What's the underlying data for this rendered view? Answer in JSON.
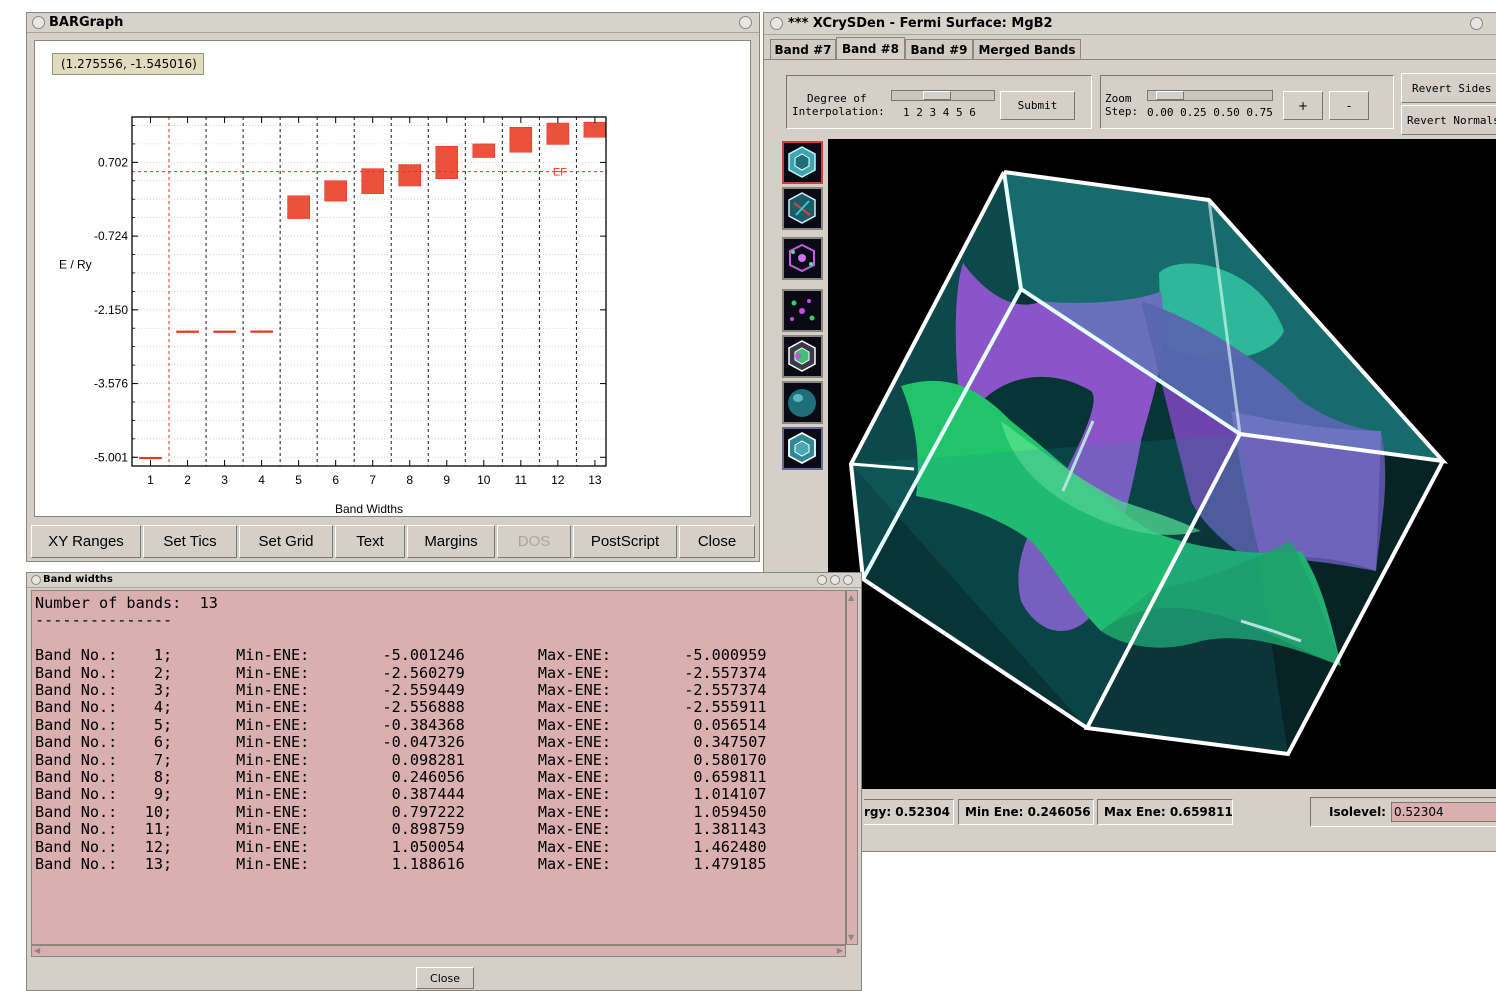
{
  "bargraph": {
    "title": "BARGraph",
    "coord_readout": "(1.275556, -1.545016)",
    "buttons": [
      "XY Ranges",
      "Set Tics",
      "Set Grid",
      "Text",
      "Margins",
      "DOS",
      "PostScript",
      "Close"
    ],
    "disabled_button": "DOS"
  },
  "chart_data": {
    "type": "bar",
    "xlabel": "Band Widths",
    "ylabel": "E / Ry",
    "x_ticks": [
      "1",
      "2",
      "3",
      "4",
      "5",
      "6",
      "7",
      "8",
      "9",
      "10",
      "11",
      "12",
      "13"
    ],
    "y_ticks": [
      "0.702",
      "-0.724",
      "-2.150",
      "-3.576",
      "-5.001"
    ],
    "y_tick_values": [
      0.702,
      -0.724,
      -2.15,
      -3.576,
      -5.001
    ],
    "ylim": [
      -5.17,
      1.58
    ],
    "xlim": [
      0.5,
      13.3
    ],
    "grid": true,
    "fermi_level": 0.52304,
    "fermi_label": "EF",
    "bar_color": "#e8341c",
    "series": [
      {
        "bands": [
          1,
          2,
          3,
          4,
          5,
          6,
          7,
          8,
          9,
          10,
          11,
          12,
          13
        ],
        "min": [
          -5.001246,
          -2.560279,
          -2.559449,
          -2.556888,
          -0.384368,
          -0.047326,
          0.098281,
          0.246056,
          0.387444,
          0.797222,
          0.898759,
          1.050054,
          1.188616
        ],
        "max": [
          -5.000959,
          -2.557374,
          -2.557374,
          -2.555911,
          0.056514,
          0.347507,
          0.58017,
          0.659811,
          1.014107,
          1.05945,
          1.381143,
          1.46248,
          1.479185
        ]
      }
    ]
  },
  "xcrysden": {
    "title": "*** XCrySDen - Fermi Surface: MgB2",
    "tabs": [
      "Band #7",
      "Band #8",
      "Band #9",
      "Merged Bands"
    ],
    "active_tab": "Band #8",
    "interp_label_1": "Degree of",
    "interp_label_2": "Interpolation:",
    "interp_scale": "1 2 3 4 5 6",
    "submit": "Submit",
    "zoom_label_1": "Zoom",
    "zoom_label_2": "Step:",
    "zoom_scale": "0.00 0.25 0.50 0.75",
    "zoom_in": "+",
    "zoom_out": "-",
    "revert_sides": "Revert Sides",
    "revert_normals": "Revert Normals",
    "status_energy": "rgy: 0.52304",
    "status_min": "Min Ene: 0.246056",
    "status_max": "Max Ene: 0.659811",
    "isolevel_label": "Isolevel:",
    "isolevel_value": "0.52304"
  },
  "bandwidths": {
    "title": "Band widths",
    "close": "Close",
    "number_label": "Number of bands:",
    "number": "13",
    "separator": "---------------",
    "row_label": "Band No.:",
    "min_label": "Min-ENE:",
    "max_label": "Max-ENE:",
    "rows": [
      {
        "band": "1",
        "min": "-5.001246",
        "max": "-5.000959"
      },
      {
        "band": "2",
        "min": "-2.560279",
        "max": "-2.557374"
      },
      {
        "band": "3",
        "min": "-2.559449",
        "max": "-2.557374"
      },
      {
        "band": "4",
        "min": "-2.556888",
        "max": "-2.555911"
      },
      {
        "band": "5",
        "min": "-0.384368",
        "max": "0.056514"
      },
      {
        "band": "6",
        "min": "-0.047326",
        "max": "0.347507"
      },
      {
        "band": "7",
        "min": "0.098281",
        "max": "0.580170"
      },
      {
        "band": "8",
        "min": "0.246056",
        "max": "0.659811"
      },
      {
        "band": "9",
        "min": "0.387444",
        "max": "1.014107"
      },
      {
        "band": "10",
        "min": "0.797222",
        "max": "1.059450"
      },
      {
        "band": "11",
        "min": "0.898759",
        "max": "1.381143"
      },
      {
        "band": "12",
        "min": "1.050054",
        "max": "1.462480"
      },
      {
        "band": "13",
        "min": "1.188616",
        "max": "1.479185"
      }
    ]
  }
}
